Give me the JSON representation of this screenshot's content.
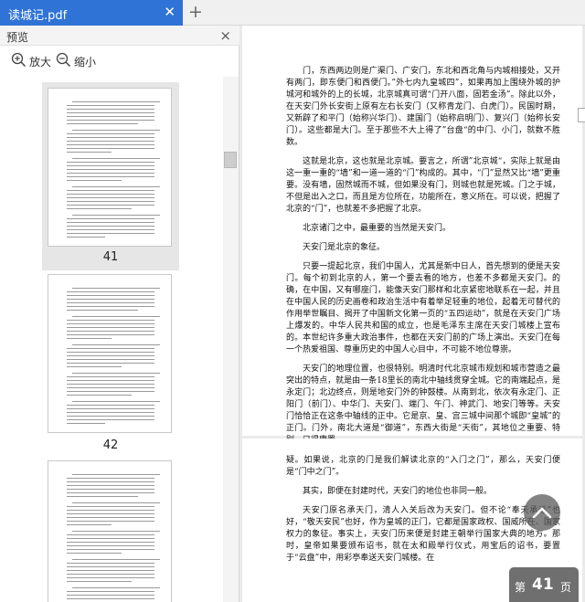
{
  "tab": {
    "title": "读城记.pdf",
    "close_glyph": "✕",
    "new_tab_glyph": "+"
  },
  "sidebar": {
    "header": "预览",
    "close_glyph": "×",
    "zoom_in_label": "放大",
    "zoom_out_label": "缩小",
    "pages": [
      "41",
      "42"
    ]
  },
  "document": {
    "page1_paragraphs": [
      "门，东西两边则是广渠门、广安门，东北和西北角与内城相接处，又开有两门，即东便门和西便门。”外七内九皇城四”，如果再加上围绕外城的护城河和城外的上的长城，北京城真可谓“门开八面，固若金汤”。除此以外，在天安门外长安街上原有左右长安门（又称青龙门、白虎门）。民国时期，又新辟了和平门（始称兴华门）、建国门（始称启明门）、复兴门（始称长安门）。这些都是大门。至于那些不大上得了”台盘“的中门、小门，就数不胜数。",
      "这就是北京，这也就是北京城。要言之，所谓”北京城“，实际上就是由这一重一重的“墙”和一道一道的“门”构成的。其中，“门”显然又比“墙”更重要。没有墙，固然城而不城，但如果没有门，则城也就是死城。门之于城，不但是出入之口，而且是方位所在，功能所在，意义所在。可以说，把握了北京的“门”，也就差不多把握了北京。",
      "北京诸门之中，最重要的当然是天安门。",
      "天安门是北京的象征。",
      "只要一提起北京，我们中国人，尤其是新中日人，首先想到的便是天安门。每个初到北京的人，第一个要去看的地方，也差不多都是天安门。的确，在中国，又有哪座门，能像天安门那样和北京紧密地联系在一起，并且在中国人民的历史画卷和政治生活中有着举足轻重的地位，起着无可替代的作用举世瞩目、揭开了中国新文化第一页的“五四运动”，就是在天安门广场上爆发的。中华人民共和国的成立，也是毛泽东主席在天安门城楼上宣布的。本世纪许多重大政治事件，也都在天安门前的广场上演出。天安门在每一个热爱祖国、尊重历史的中国人心目中，不可能不地位尊崇。",
      "天安门的地理位置，也很特别。明清时代北京城市规划和城市营造之最突出的特点，就是由一条18里长的南北中轴线贯穿全城。它的南端起点，是永定门；北边终点，则是地安门外的钟鼓楼。从南到北，依次有永定门、正阳门（前门）、中华门、天安门、端门、午门、神武门、地安门等等。天安门恰恰正在这条中轴线的正中。它是京、皇、宫三城中间那个城即“皇城”的正门。门外，南北大道是“御道”，东西大街是“天街”，其地位之重要、特别，已得庸置"
    ],
    "page2_paragraphs": [
      "疑。如果说，北京的门是我们解读北京的“入门之门”，那么，天安门便是“门中之门”。",
      "其实，即便在封建时代，天安门的地位也非同一般。",
      "天安门原名承天门，清人入关后改为天安门。但不论“奉天承运”也好，“敬天安民”也好，作为皇城的正门，它都是国家政权、国威所在、国家权力的象征。事实上，天安门历来便是封建王朝举行国家大典的地方。那时，皇帝如果要颁布诏书，就在太和殿举行仪式，用宝后的诏书，要置于“云盘”中，用彩亭奉送天安门城楼。在"
    ]
  },
  "page_indicator": {
    "prefix": "第",
    "current": "41",
    "suffix": "页"
  }
}
